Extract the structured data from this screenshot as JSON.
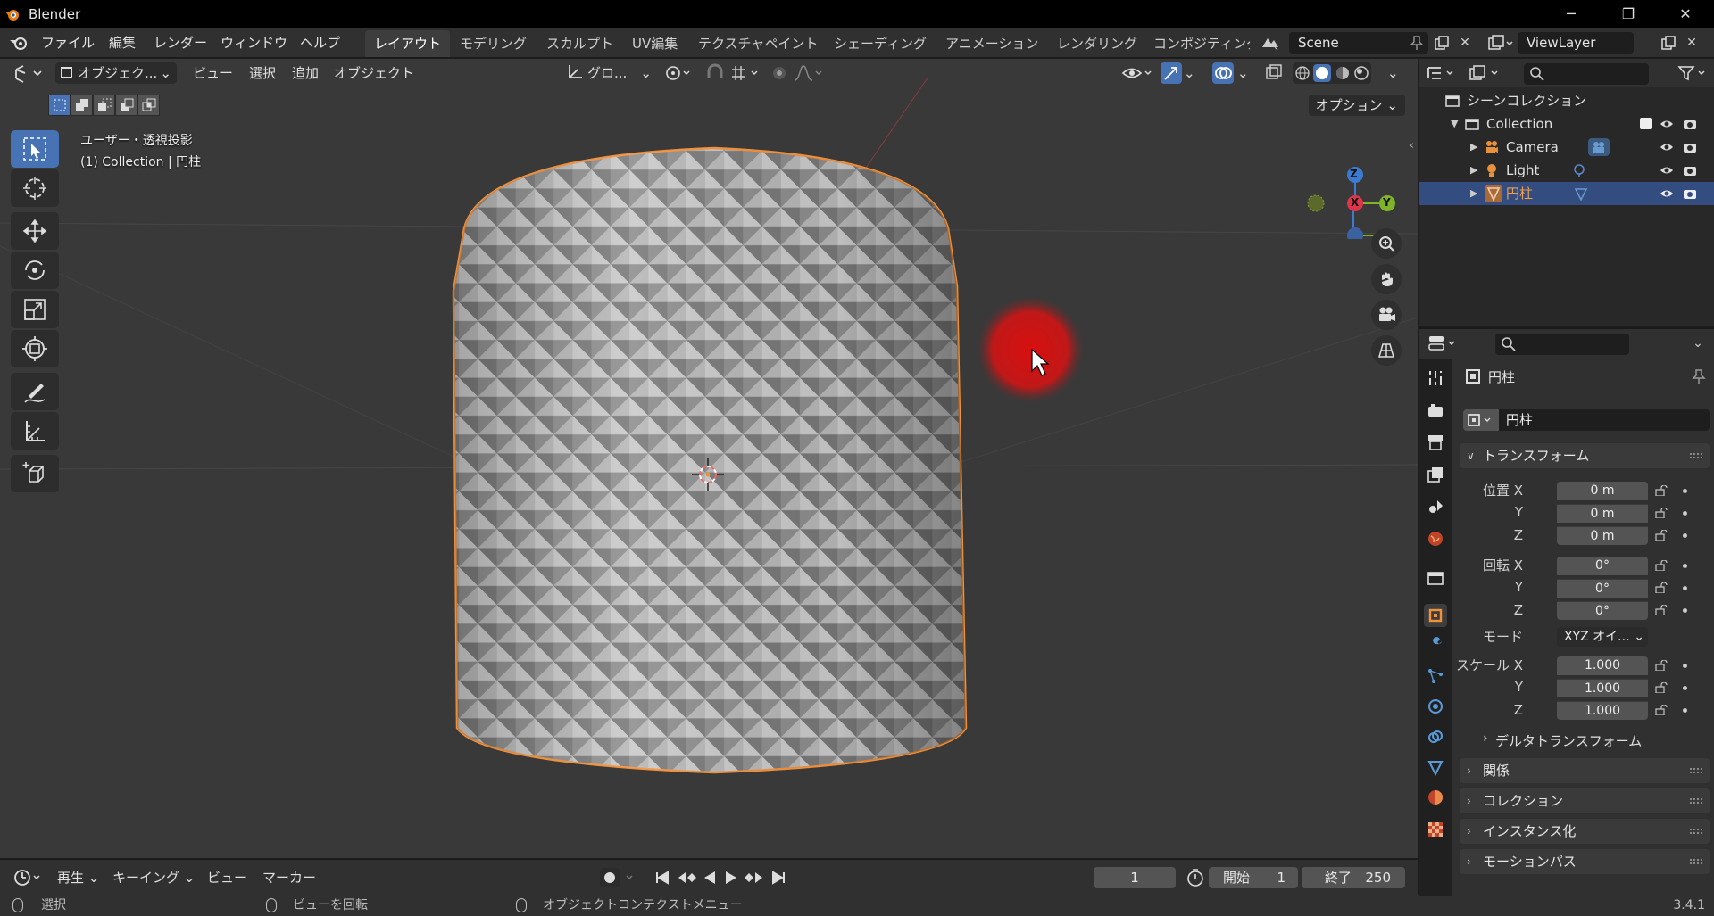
{
  "titlebar": {
    "title": "Blender",
    "minimize": "─",
    "maximize": "❐",
    "close": "✕"
  },
  "menu": {
    "file": "ファイル",
    "edit": "編集",
    "render": "レンダー",
    "window": "ウィンドウ",
    "help": "ヘルプ"
  },
  "workspaces": [
    "レイアウト",
    "モデリング",
    "スカルプト",
    "UV編集",
    "テクスチャペイント",
    "シェーディング",
    "アニメーション",
    "レンダリング",
    "コンポジティング"
  ],
  "active_workspace": "レイアウト",
  "scene": {
    "name": "Scene",
    "view_layer": "ViewLayer"
  },
  "viewport": {
    "mode": "オブジェク...",
    "menu_view": "ビュー",
    "menu_select": "選択",
    "menu_add": "追加",
    "menu_object": "オブジェクト",
    "transform_orientation": "グロ...",
    "options": "オプション",
    "info_line1": "ユーザー・透視投影",
    "info_line2": "(1) Collection | 円柱",
    "gizmo": {
      "z": "Z",
      "y": "Y",
      "x": "X"
    }
  },
  "outliner": {
    "scene_collection": "シーンコレクション",
    "items": [
      {
        "name": "Collection",
        "type": "collection"
      },
      {
        "name": "Camera",
        "type": "camera"
      },
      {
        "name": "Light",
        "type": "light"
      },
      {
        "name": "円柱",
        "type": "mesh",
        "selected": true
      }
    ]
  },
  "properties": {
    "object_name": "円柱",
    "data_name": "円柱",
    "transform_panel": "トランスフォーム",
    "location_label": "位置 X",
    "rotation_label": "回転 X",
    "scale_label": "スケール X",
    "y_label": "Y",
    "z_label": "Z",
    "location": [
      "0 m",
      "0 m",
      "0 m"
    ],
    "rotation": [
      "0°",
      "0°",
      "0°"
    ],
    "mode_label": "モード",
    "mode_value": "XYZ オイ...",
    "scale": [
      "1.000",
      "1.000",
      "1.000"
    ],
    "delta_transform": "デルタトランスフォーム",
    "panels": [
      "関係",
      "コレクション",
      "インスタンス化",
      "モーションパス"
    ]
  },
  "timeline": {
    "playback": "再生",
    "keying": "キーイング",
    "view": "ビュー",
    "marker": "マーカー",
    "current_frame": "1",
    "start_label": "開始",
    "start": "1",
    "end_label": "終了",
    "end": "250"
  },
  "statusbar": {
    "select": "選択",
    "rotate_view": "ビューを回転",
    "context_menu": "オブジェクトコンテクストメニュー",
    "version": "3.4.1"
  },
  "colors": {
    "accent": "#4772b3",
    "selection_outline": "#f0913c",
    "cursor_marker": "#d21e1e",
    "axis_x": "#e0344a",
    "axis_y": "#7fb32a",
    "axis_z": "#3b7bd1"
  }
}
